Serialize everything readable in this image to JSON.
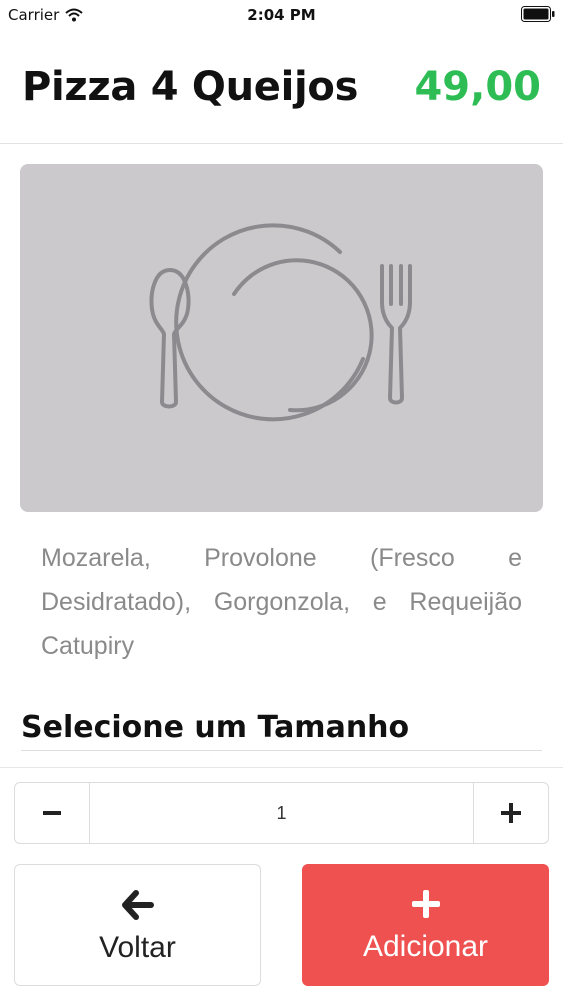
{
  "status_bar": {
    "carrier": "Carrier",
    "time": "2:04 PM"
  },
  "product": {
    "title": "Pizza 4 Queijos",
    "price": "49,00",
    "price_color": "#2ebd55",
    "image_icon": "plate-fork-spoon-icon",
    "description": "Mozarela, Provolone (Fresco e Desidratado), Gorgonzola, e Requeijão Catupiry"
  },
  "size_section": {
    "title": "Selecione um Tamanho"
  },
  "quantity": {
    "value": "1",
    "minus_icon": "minus-icon",
    "plus_icon": "plus-icon"
  },
  "actions": {
    "back_label": "Voltar",
    "back_icon": "arrow-left-icon",
    "add_label": "Adicionar",
    "add_icon": "plus-icon",
    "add_color": "#ef5050"
  }
}
